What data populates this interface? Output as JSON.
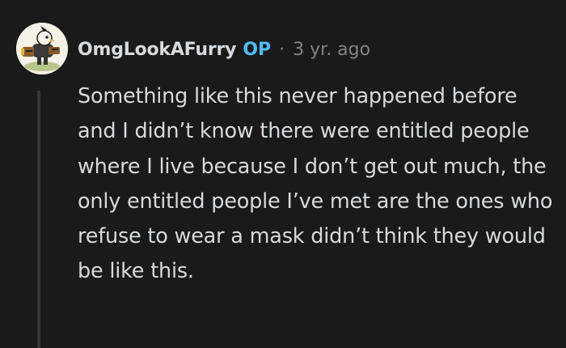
{
  "comment": {
    "author": "OmgLookAFurry",
    "op_badge": "OP",
    "separator": "·",
    "timestamp": "3 yr. ago",
    "body": "Something like this never happened before and I didn’t know there were entitled people where I live because I don’t get out much, the only entitled people I’ve met are the ones who refuse to wear a mask didn’t think they would be like this.",
    "avatar_icon": "cartoon-character-avatar"
  },
  "colors": {
    "background": "#1a1a1b",
    "text": "#d7dadc",
    "muted": "#818384",
    "op_badge": "#4fbcff",
    "thread_line": "#343536"
  }
}
